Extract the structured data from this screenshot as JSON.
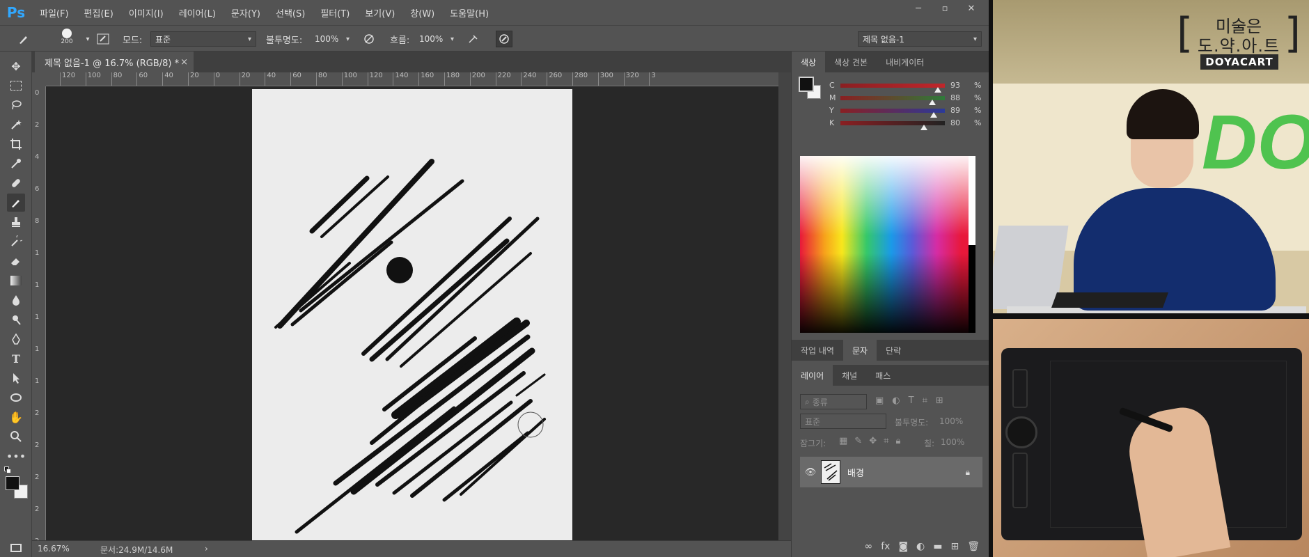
{
  "app": {
    "logo": "Ps"
  },
  "menu": [
    "파일(F)",
    "편집(E)",
    "이미지(I)",
    "레이어(L)",
    "문자(Y)",
    "선택(S)",
    "필터(T)",
    "보기(V)",
    "창(W)",
    "도움말(H)"
  ],
  "window_controls": {
    "minimize": "─",
    "restore": "▫",
    "close": "✕"
  },
  "options": {
    "brush_size": "200",
    "mode_label": "모드:",
    "mode_value": "표준",
    "opacity_label": "불투명도:",
    "opacity_value": "100%",
    "flow_label": "흐름:",
    "flow_value": "100%",
    "workspace_value": "제목 없음-1"
  },
  "document_tab": {
    "title": "제목 없음-1 @ 16.7% (RGB/8) *",
    "close": "×"
  },
  "ruler_h": [
    "120",
    "100",
    "80",
    "60",
    "40",
    "20",
    "0",
    "20",
    "40",
    "60",
    "80",
    "100",
    "120",
    "140",
    "160",
    "180",
    "200",
    "220",
    "240",
    "260",
    "280",
    "300",
    "320",
    "3"
  ],
  "ruler_v": [
    "0",
    "2",
    "4",
    "6",
    "8",
    "1",
    "1",
    "1",
    "1",
    "1",
    "2",
    "2",
    "2",
    "2",
    "2"
  ],
  "status": {
    "zoom": "16.67%",
    "doc_size": "문서:24.9M/14.6M",
    "arrow": "›"
  },
  "color_panel": {
    "tabs": [
      "색상",
      "색상 견본",
      "내비게이터"
    ],
    "active_tab": "색상",
    "cmyk": [
      {
        "label": "C",
        "value": "93",
        "pct": "%",
        "position": 0.93,
        "color": "#c0262b"
      },
      {
        "label": "M",
        "value": "88",
        "pct": "%",
        "position": 0.88,
        "color": "#2f7a3a"
      },
      {
        "label": "Y",
        "value": "89",
        "pct": "%",
        "position": 0.89,
        "color": "#2b3a9a"
      },
      {
        "label": "K",
        "value": "80",
        "pct": "%",
        "position": 0.8,
        "color": "#222222"
      }
    ]
  },
  "mid_tabs": [
    "작업 내역",
    "문자",
    "단락"
  ],
  "mid_active": "문자",
  "layers_panel": {
    "tabs": [
      "레이어",
      "채널",
      "패스"
    ],
    "active_tab": "레이어",
    "filter_label": "종류",
    "blend_mode": "표준",
    "opacity_label": "불투명도:",
    "opacity_value": "100%",
    "lock_label": "잠그기:",
    "fill_label": "칠:",
    "fill_value": "100%",
    "layers": [
      {
        "name": "배경",
        "visible": true,
        "locked": true
      }
    ]
  },
  "layer_footer_icons": [
    "link-icon",
    "fx-icon",
    "mask-icon",
    "adjustment-icon",
    "folder-icon",
    "new-layer-icon",
    "trash-icon"
  ],
  "video": {
    "channel_title": "미술은",
    "channel_subtitle": "도.약.아.트",
    "channel_badge": "DOYACART",
    "banner_text": "DO"
  },
  "colors": {
    "ps_blue": "#31a8ff",
    "panel": "#535353",
    "workspace": "#282828",
    "canvas": "#ececec"
  }
}
